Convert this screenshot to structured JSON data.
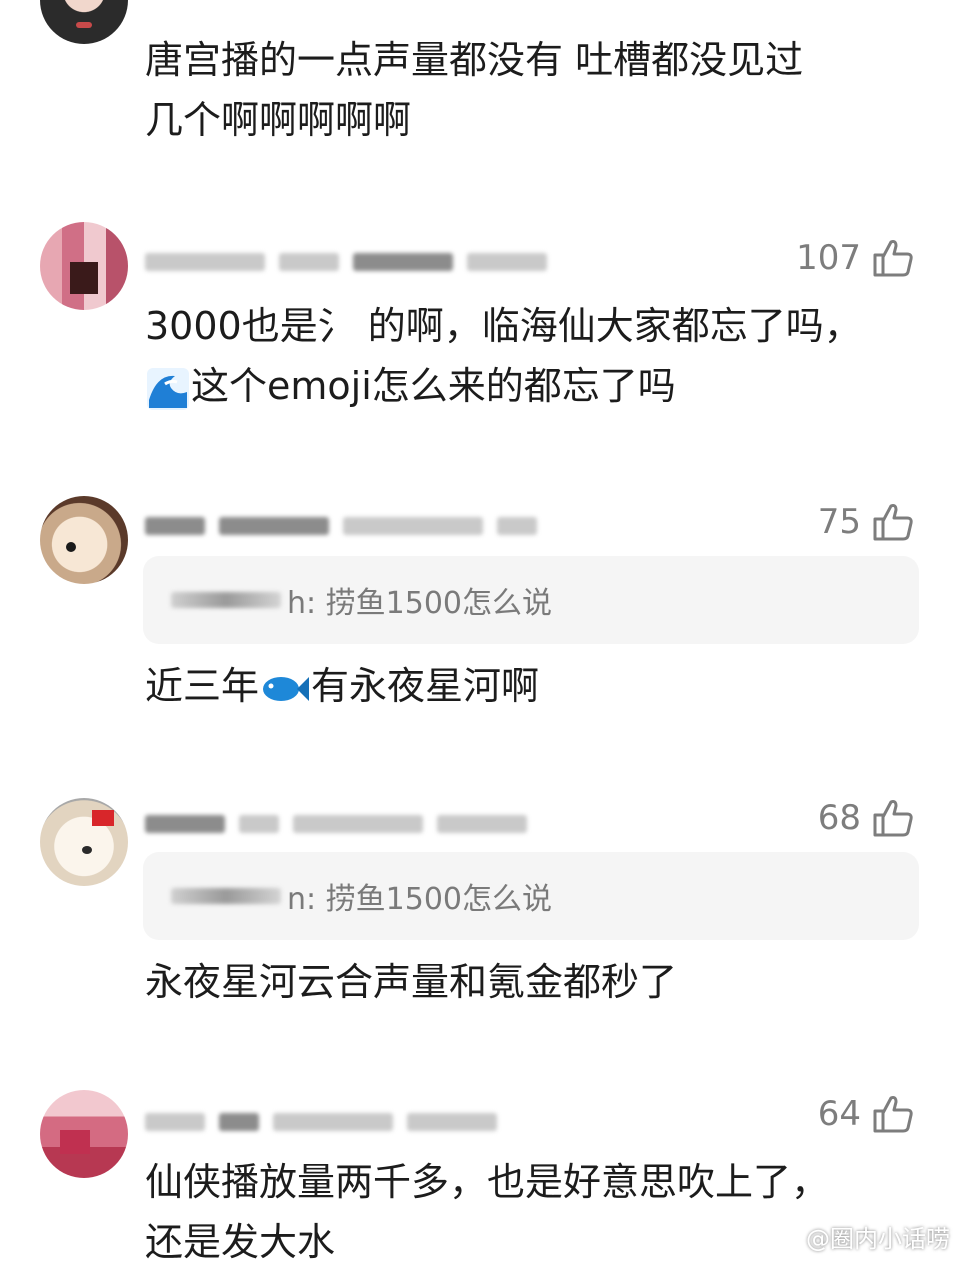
{
  "comments": [
    {
      "text_lines": [
        "唐宫播的一点声量都没有  吐槽都没见过",
        "几个啊啊啊啊啊"
      ]
    },
    {
      "likes": "107",
      "text_lines": [
        "3000也是氵 的啊，临海仙大家都忘了吗，",
        "这个emoji怎么来的都忘了吗"
      ],
      "emoji": "wave-emoji"
    },
    {
      "likes": "75",
      "reply_text": "h: 捞鱼1500怎么说",
      "text_before": "近三年",
      "text_after": "有永夜星河啊",
      "emoji": "fish-emoji"
    },
    {
      "likes": "68",
      "reply_text": "n: 捞鱼1500怎么说",
      "text_lines": [
        "永夜星河云合声量和氪金都秒了"
      ]
    },
    {
      "likes": "64",
      "text_lines": [
        "仙侠播放量两千多，也是好意思吹上了，",
        "还是发大水"
      ]
    }
  ],
  "watermark": {
    "text": "@圈内小话唠",
    "icon": "weibo-icon"
  },
  "colors": {
    "text": "#1c1c1c",
    "meta": "#7d7d7d",
    "reply_bg": "#f5f5f5"
  }
}
